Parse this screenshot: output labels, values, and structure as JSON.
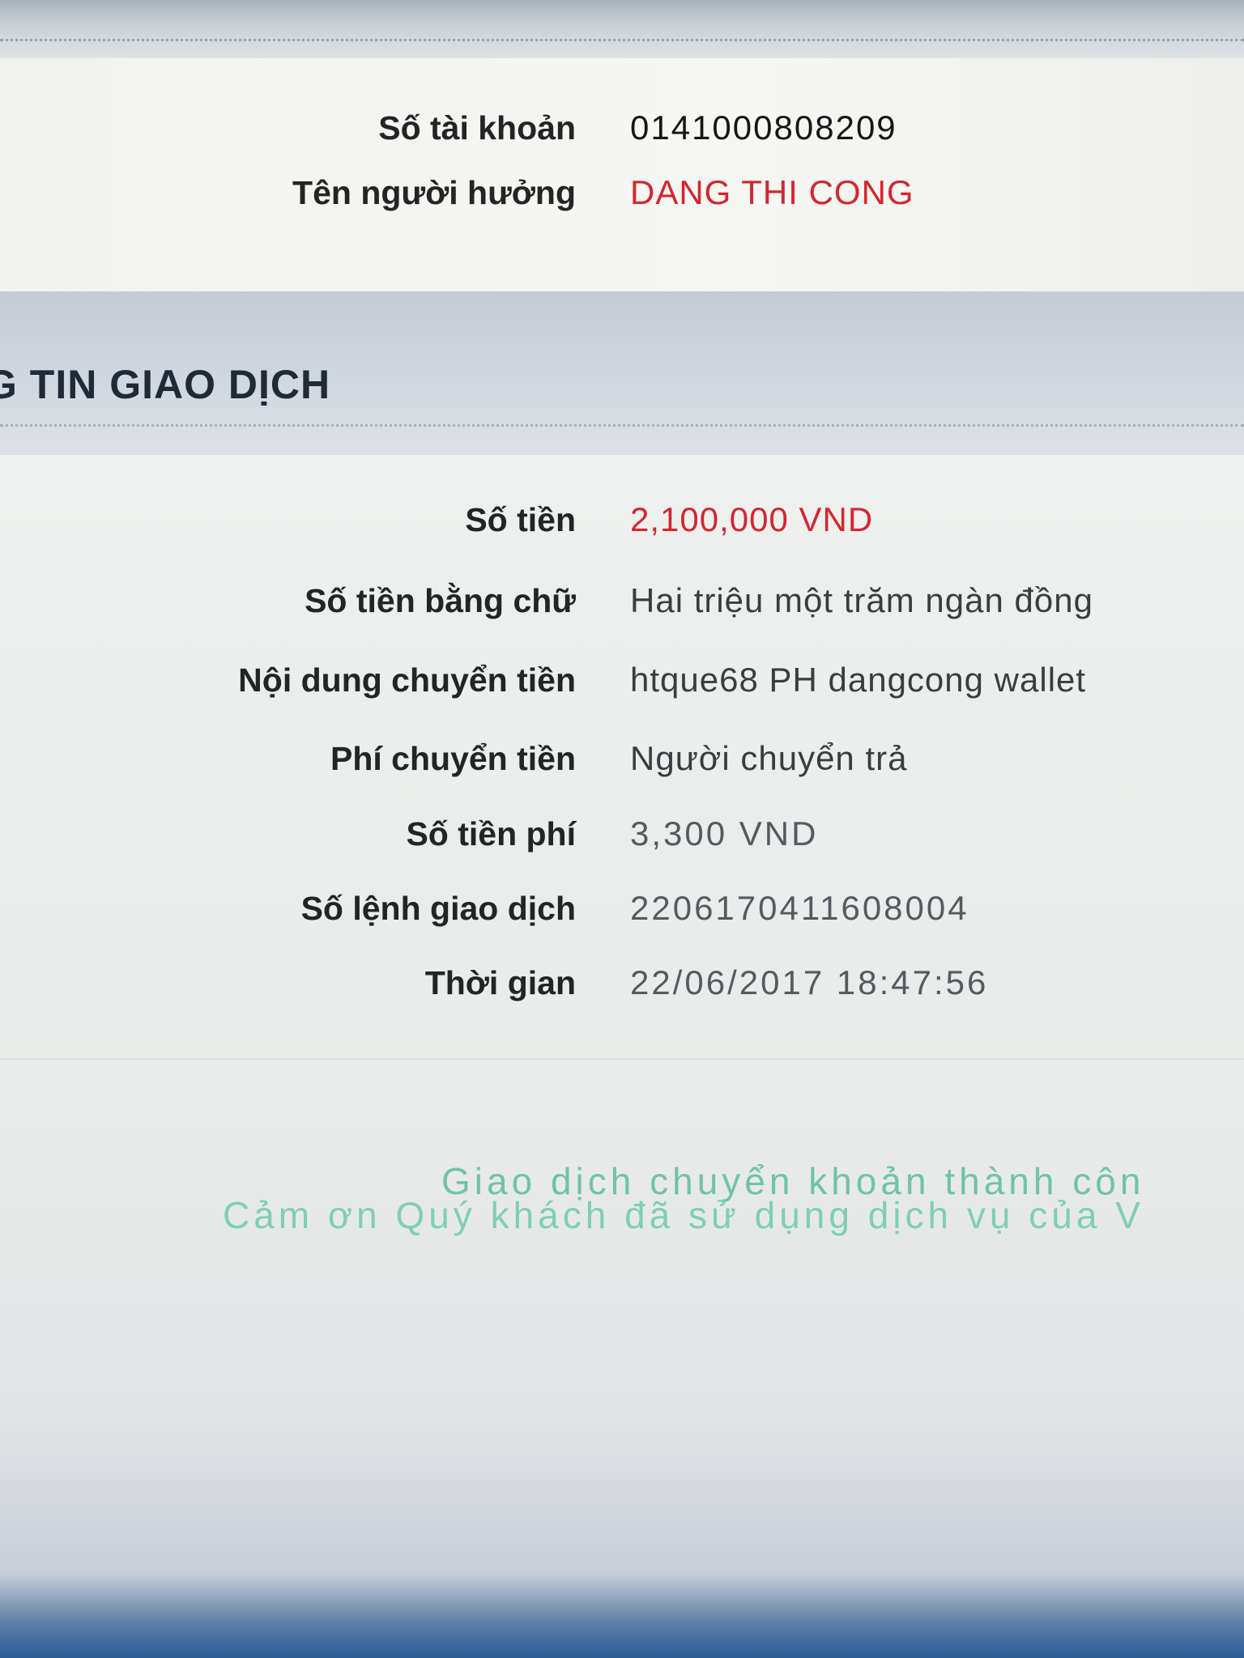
{
  "beneficiary": {
    "account_number_label": "Số tài khoản",
    "account_number": "0141000808209",
    "beneficiary_name_label": "Tên người hưởng",
    "beneficiary_name": "DANG THI CONG"
  },
  "transaction_section": {
    "title": "G TIN GIAO DỊCH",
    "amount_label": "Số tiền",
    "amount": "2,100,000 VND",
    "amount_in_words_label": "Số tiền bằng chữ",
    "amount_in_words": "Hai triệu một trăm ngàn đồng",
    "content_label": "Nội dung chuyển tiền",
    "content": "htque68 PH dangcong wallet",
    "fee_payer_label": "Phí chuyển tiền",
    "fee_payer": "Người chuyển trả",
    "fee_amount_label": "Số tiền phí",
    "fee_amount": "3,300 VND",
    "order_number_label": "Số lệnh giao dịch",
    "order_number": "2206170411608004",
    "time_label": "Thời gian",
    "time": "22/06/2017 18:47:56"
  },
  "messages": {
    "success": "Giao dịch chuyển khoản thành côn",
    "thanks": "Cảm ơn Quý khách đã sử dụng dịch vụ của V"
  },
  "colors": {
    "highlight_red": "#d42630",
    "success_green": "#6fc4a4"
  }
}
